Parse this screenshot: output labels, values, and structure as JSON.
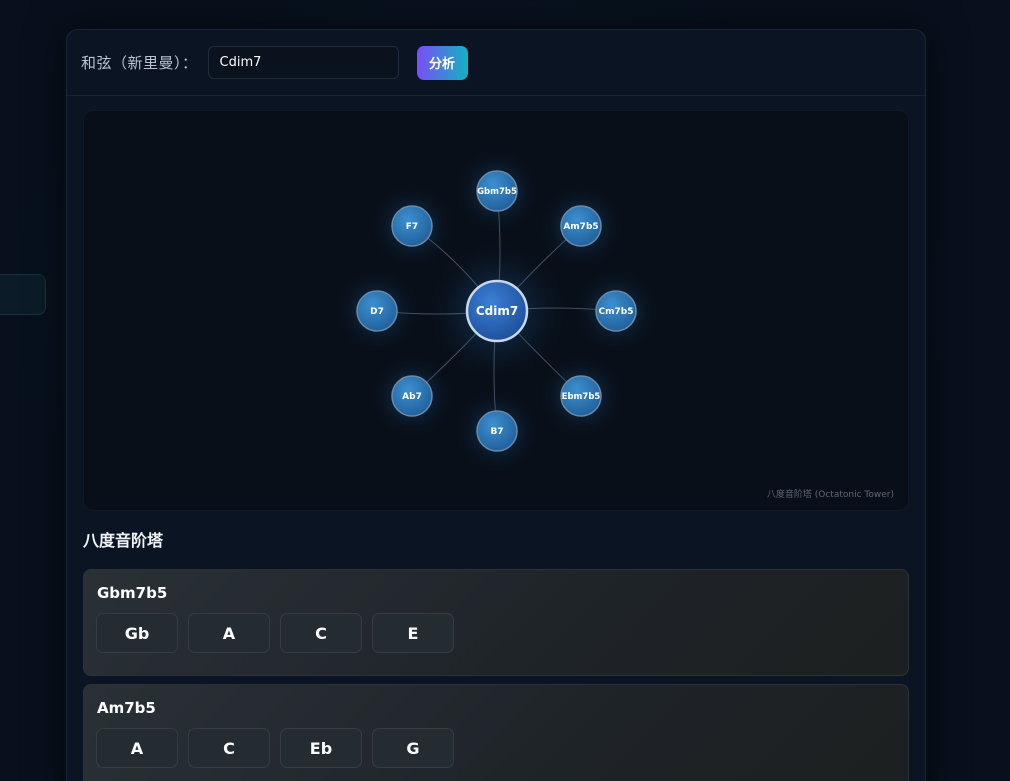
{
  "header": {
    "chord_label": "和弦（新里曼）：",
    "chord_value": "Cdim7",
    "analyze_label": "分析"
  },
  "graph": {
    "center": "Cdim7",
    "nodes": [
      "Gbm7b5",
      "Am7b5",
      "Cm7b5",
      "Ebm7b5",
      "B7",
      "Ab7",
      "D7",
      "F7"
    ],
    "caption": "八度音阶塔 (Octatonic Tower)"
  },
  "section_title": "八度音阶塔",
  "cards": [
    {
      "title": "Gbm7b5",
      "notes": [
        "Gb",
        "A",
        "C",
        "E"
      ]
    },
    {
      "title": "Am7b5",
      "notes": [
        "A",
        "C",
        "Eb",
        "G"
      ]
    }
  ],
  "colors": {
    "accent_start": "#7b4df6",
    "accent_end": "#11b3c2",
    "node": "#2f7fc1"
  }
}
